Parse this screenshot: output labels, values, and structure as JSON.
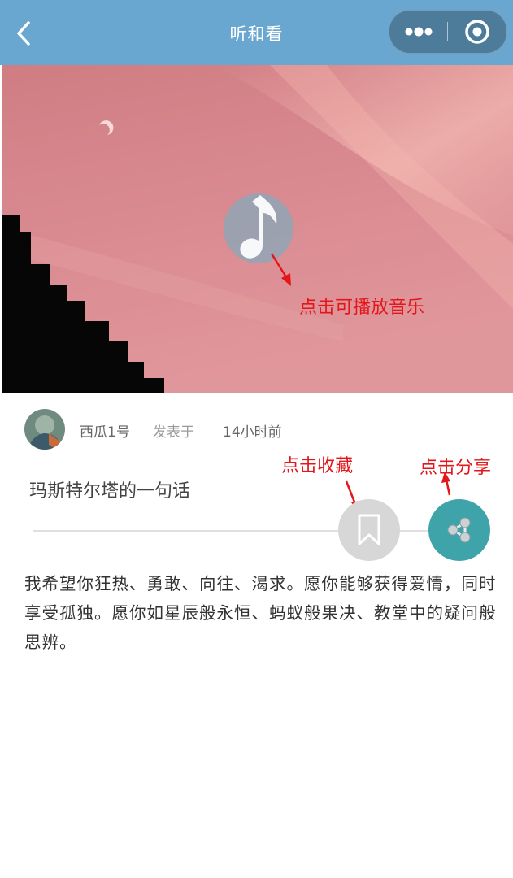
{
  "navbar": {
    "title": "听和看"
  },
  "annotations": {
    "play": "点击可播放音乐",
    "favorite": "点击收藏",
    "share": "点击分享"
  },
  "post": {
    "author": "西瓜1号",
    "posted_label": "发表于",
    "time": "14小时前",
    "title": "玛斯特尔塔的一句话",
    "body": "我希望你狂热、勇敢、向往、渴求。愿你能够获得爱情，同时享受孤独。愿你如星辰般永恒、蚂蚁般果决、教堂中的疑问般思辨。"
  },
  "colors": {
    "navbar": "#6aa7d0",
    "annotation": "#e3161a",
    "share_button": "#3fa4aa",
    "favorite_button": "#d7d7d7"
  },
  "icons": {
    "back": "chevron-left-icon",
    "menu": "more-dots-icon",
    "close": "target-circle-icon",
    "play": "music-note-icon",
    "favorite": "bookmark-icon",
    "share": "share-icon"
  }
}
